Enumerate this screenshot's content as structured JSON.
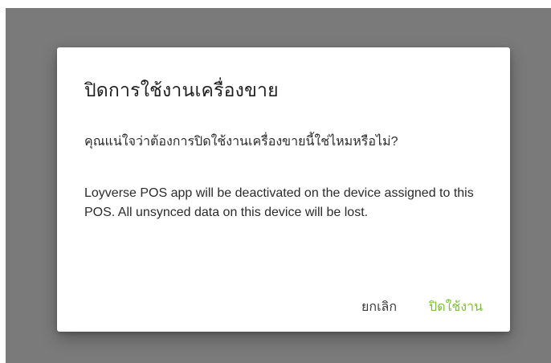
{
  "dialog": {
    "title": "ปิดการใช้งานเครื่องขาย",
    "question": "คุณแน่ใจว่าต้องการปิดใช้งานเครื่องขายนี้ใช่ไหมหรือไม่?",
    "message": "Loyverse POS app will be deactivated on the device assigned to this POS. All unsynced data on this device will be lost.",
    "cancel_label": "ยกเลิก",
    "confirm_label": "ปิดใช้งาน"
  },
  "colors": {
    "overlay": "#7a7a7a",
    "accent": "#7bbf3b"
  }
}
